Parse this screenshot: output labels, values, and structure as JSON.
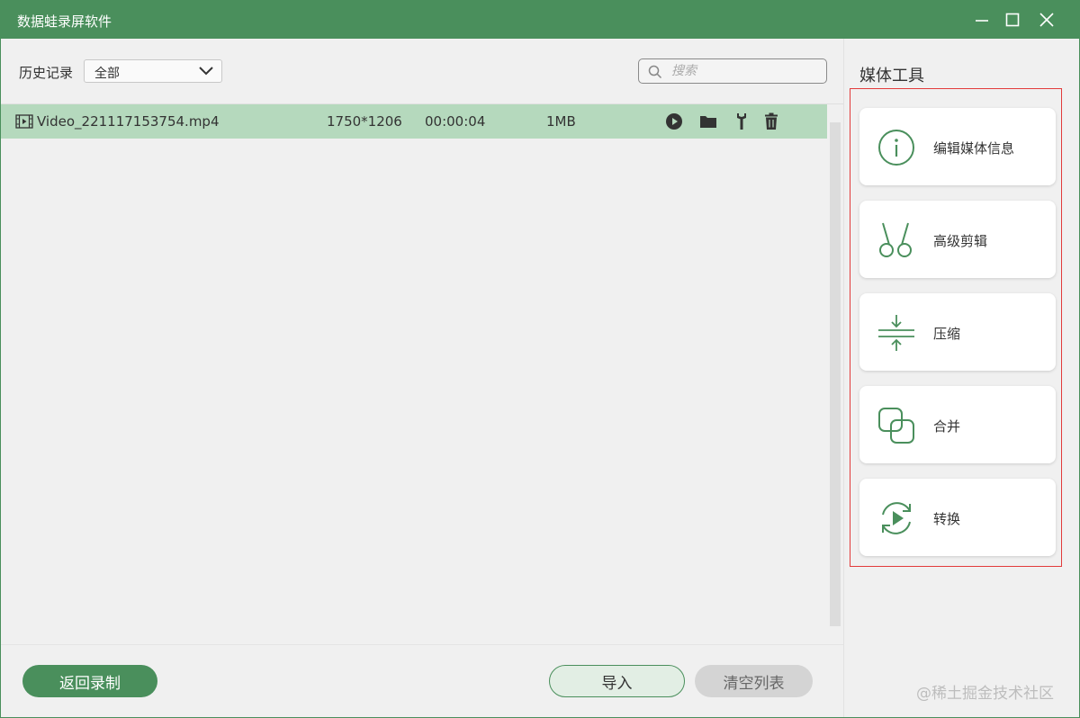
{
  "window": {
    "title": "数据蛙录屏软件"
  },
  "history": {
    "label": "历史记录",
    "filter_value": "全部",
    "search_placeholder": "搜索"
  },
  "files": [
    {
      "name": "Video_221117153754.mp4",
      "resolution": "1750*1206",
      "duration": "00:00:04",
      "size": "1MB"
    }
  ],
  "media_tools": {
    "title": "媒体工具",
    "items": [
      {
        "label": "编辑媒体信息",
        "icon": "info-icon"
      },
      {
        "label": "高级剪辑",
        "icon": "scissors-icon"
      },
      {
        "label": "压缩",
        "icon": "compress-icon"
      },
      {
        "label": "合并",
        "icon": "merge-icon"
      },
      {
        "label": "转换",
        "icon": "convert-icon"
      }
    ]
  },
  "buttons": {
    "back": "返回录制",
    "import": "导入",
    "clear": "清空列表"
  },
  "watermark": "@稀土掘金技术社区",
  "colors": {
    "accent": "#4a8f5c",
    "row_selected": "#b5d9bd",
    "highlight_border": "#e23b3b"
  }
}
